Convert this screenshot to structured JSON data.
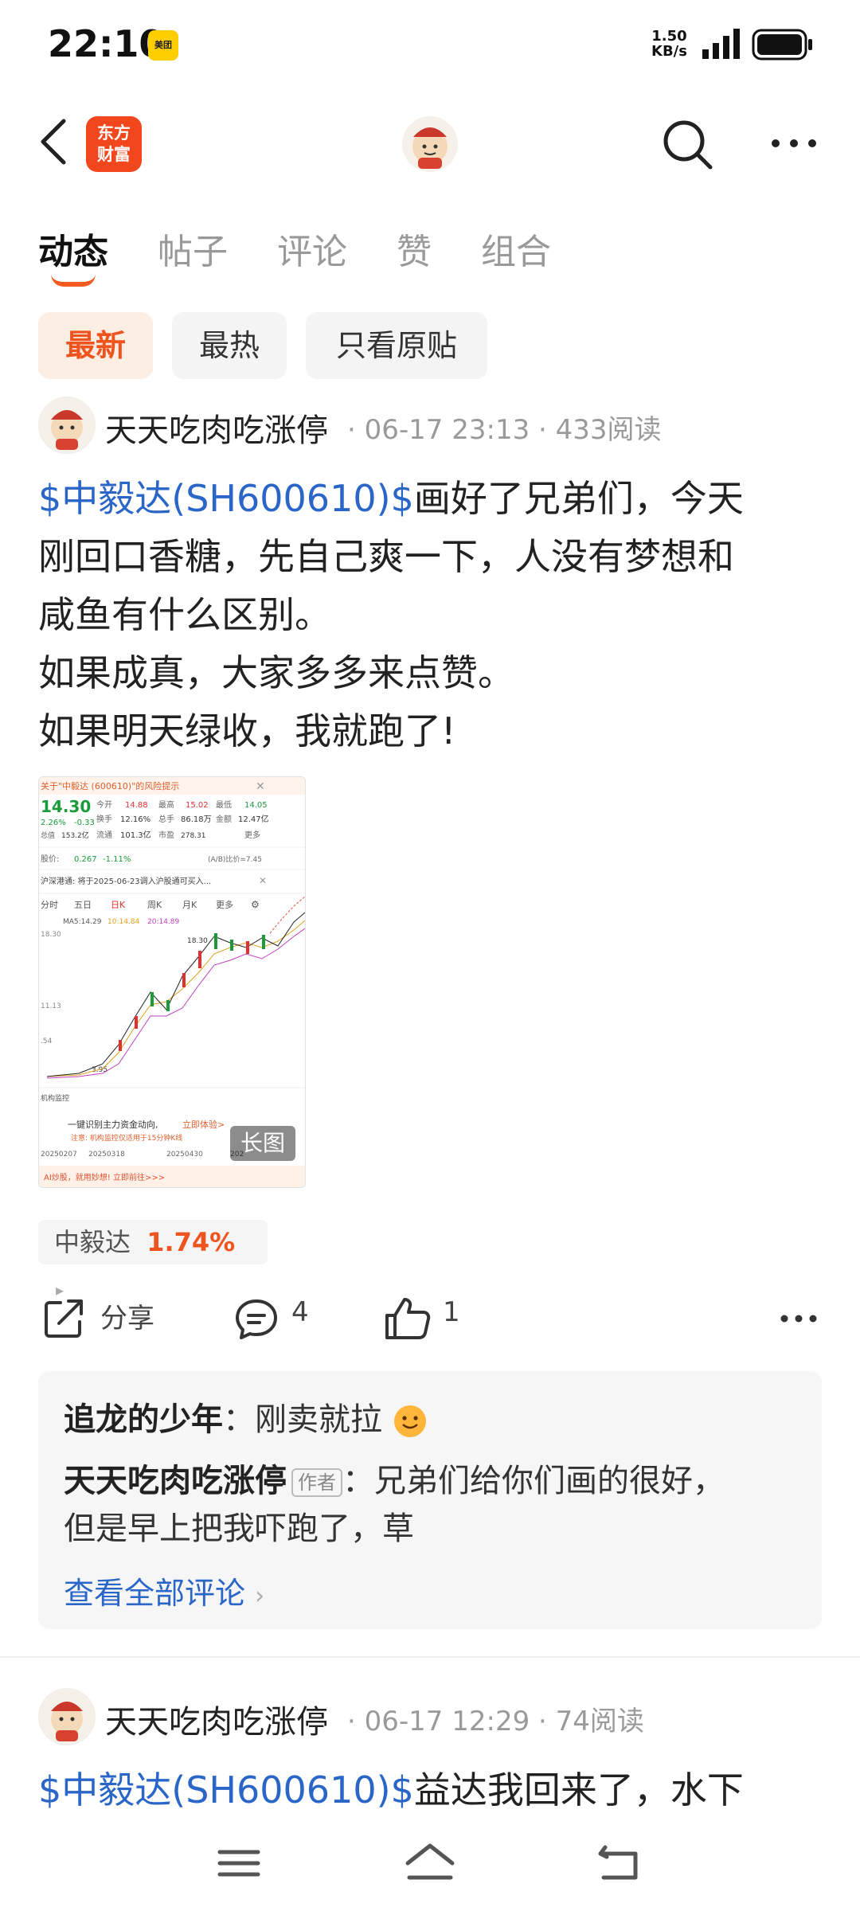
{
  "status_bar": {
    "time": "22:10",
    "meituan": "美团",
    "speed_value": "1.50",
    "speed_unit": "KB/s"
  },
  "header": {
    "logo_line1": "东方",
    "logo_line2": "财富"
  },
  "tabs": [
    {
      "label": "动态",
      "active": true
    },
    {
      "label": "帖子"
    },
    {
      "label": "评论"
    },
    {
      "label": "赞"
    },
    {
      "label": "组合"
    }
  ],
  "filters": [
    {
      "label": "最新",
      "active": true
    },
    {
      "label": "最热"
    },
    {
      "label": "只看原贴"
    }
  ],
  "post1": {
    "author": "天天吃肉吃涨停",
    "date": "06-17 23:13",
    "reads": "433阅读",
    "stock_link": "$中毅达(SH600610)$",
    "line1_rest": "画好了兄弟们，今天",
    "line2": "刚回口香糖，先自己爽一下，人没有梦想和",
    "line3": "咸鱼有什么区别。",
    "line4": "如果成真，大家多多来点赞。",
    "line5": "如果明天绿收，我就跑了!",
    "image_badge": "长图",
    "stock_chip": {
      "name": "中毅达",
      "change": "1.74%"
    },
    "actions": {
      "share": "分享",
      "comments": "4",
      "likes": "1"
    },
    "comments": [
      {
        "name": "追龙的少年",
        "text": "刚卖就拉"
      },
      {
        "name": "天天吃肉吃涨停",
        "tag": "作者",
        "text_line1": "兄弟们给你们画的很好，",
        "text_line2": "但是早上把我吓跑了，草"
      }
    ],
    "view_all": "查看全部评论"
  },
  "post2": {
    "author": "天天吃肉吃涨停",
    "date": "06-17 12:29",
    "reads": "74阅读",
    "stock_link": "$中毅达(SH600610)$",
    "line1_rest": "益达我回来了，水下"
  },
  "screenshot": {
    "risk_title": "关于\"中毅达 (600610)\"的风险提示",
    "price": "14.30",
    "change_pct": "2.26%",
    "change_abs": "-0.33",
    "row1": [
      "今开",
      "14.88",
      "最高",
      "15.02",
      "最低",
      "14.05"
    ],
    "row2": [
      "换手",
      "12.16%",
      "总手",
      "86.18万",
      "金额",
      "12.47亿"
    ],
    "row3": [
      "总值",
      "153.2亿",
      "流通",
      "101.3亿",
      "市盈",
      "278.31"
    ],
    "more": "更多",
    "ah_label": "股价:",
    "ah_value": "0.267",
    "ah_pct": "-1.11%",
    "ah_ratio": "(A/B)比价=7.45",
    "notice": "沪深港通: 将于2025-06-23调入沪股通可买入...",
    "kline_tabs": [
      "分时",
      "五日",
      "日K",
      "周K",
      "月K",
      "更多"
    ],
    "ma": "MA5:14.29",
    "ma10": "10:14.84",
    "ma20": "20:14.89",
    "y_top": "18.30",
    "y_mid": "11.13",
    "y_low": ".54",
    "peak": "18.30",
    "low_mark": "3.95",
    "monitor": "机构监控",
    "promo": "一键识别主力资金动向,",
    "promo_link": "立即体验>",
    "promo_note": "注意: 机构监控仅适用于15分钟K线",
    "dates": [
      "20250207",
      "20250318",
      "20250430",
      "202"
    ],
    "ai_bar": "AI炒股，就用妙想! 立即前往>>>"
  }
}
